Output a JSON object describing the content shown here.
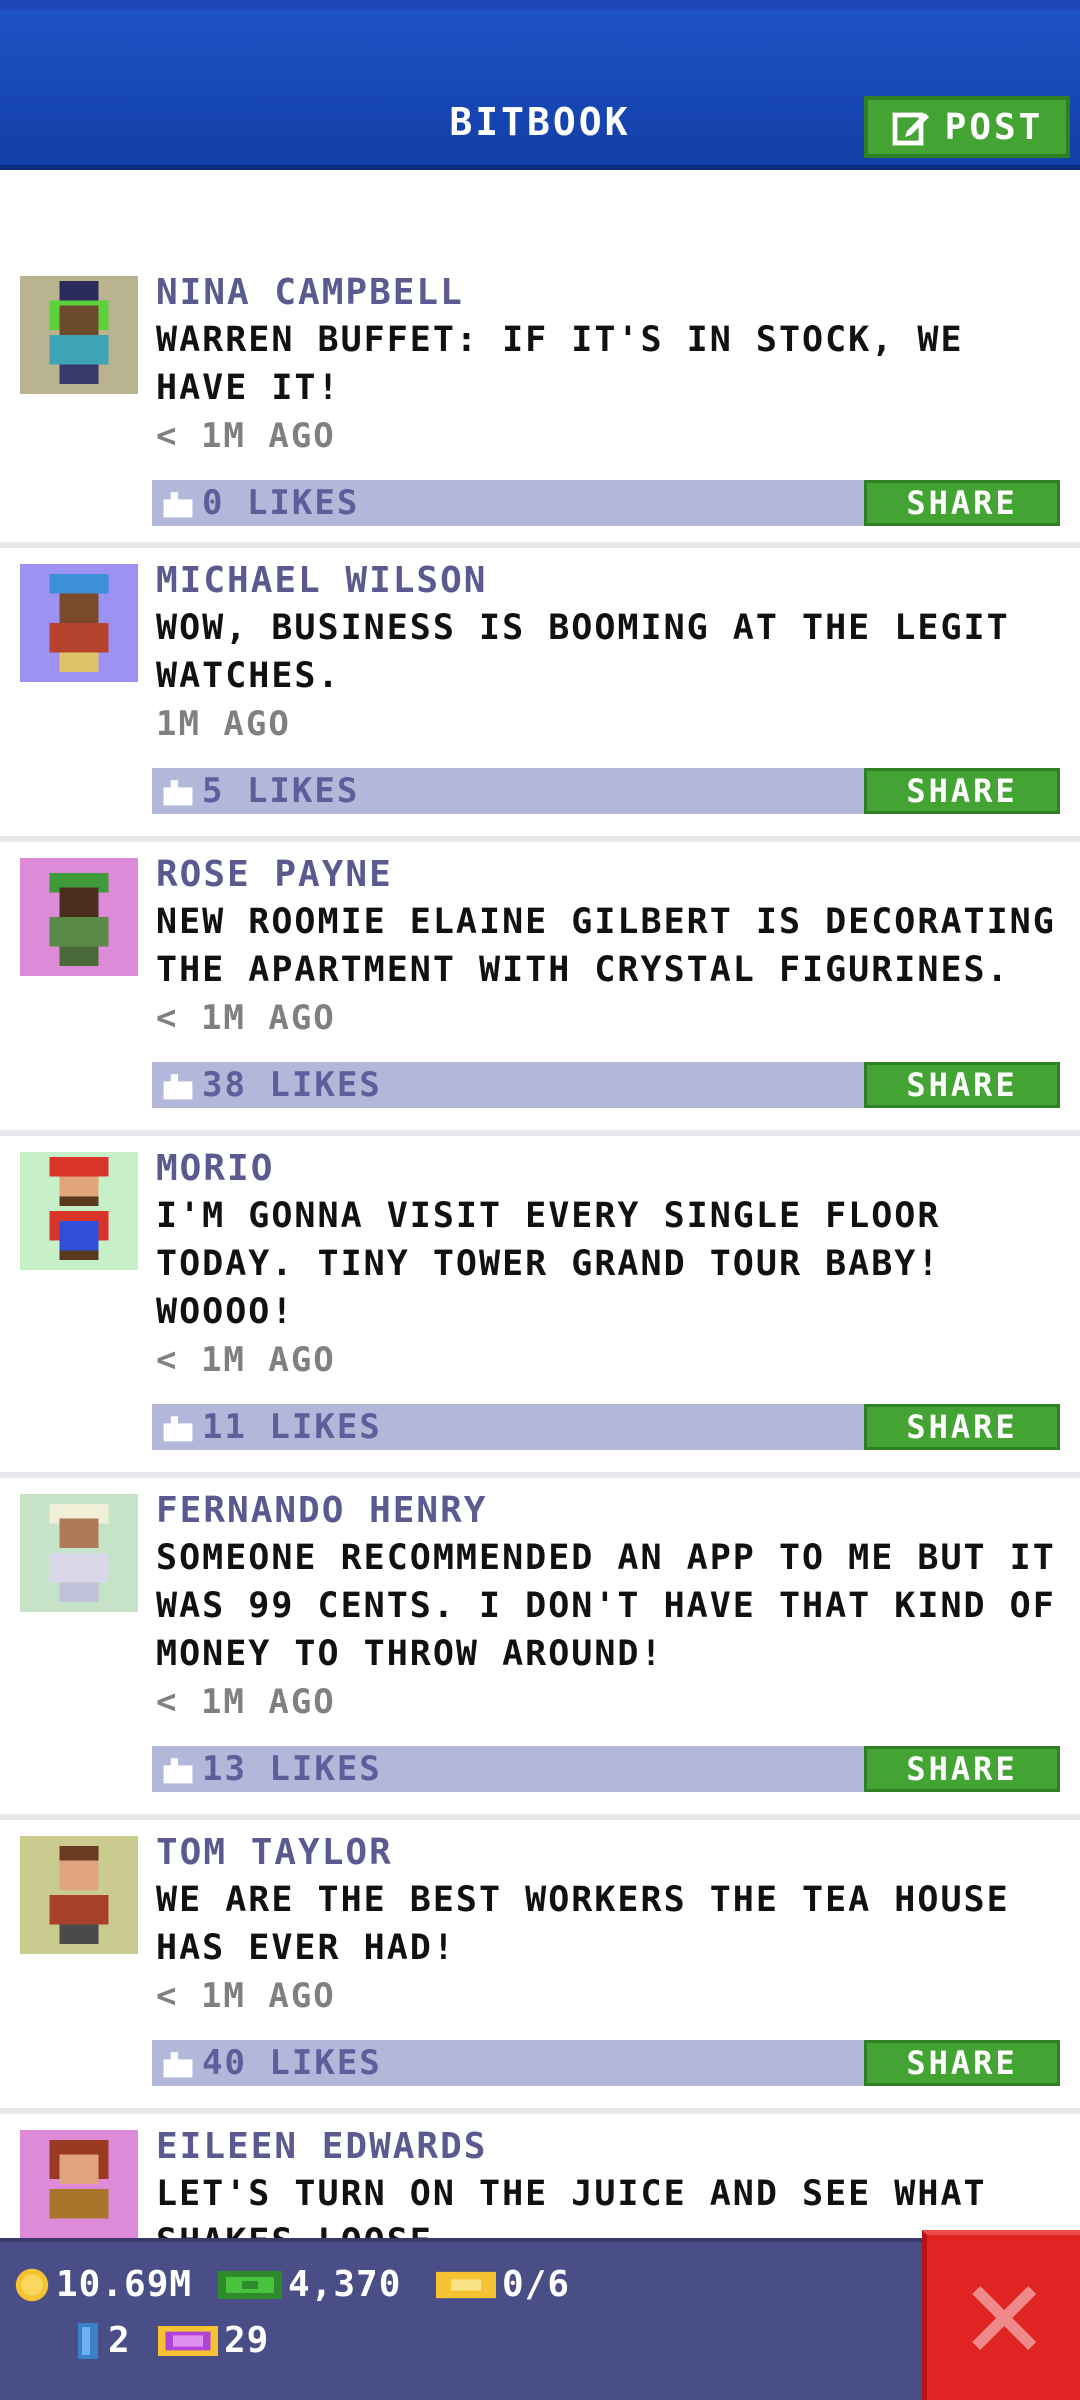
{
  "header": {
    "title": "BITBOOK",
    "post_label": "POST"
  },
  "posts": [
    {
      "name": "NINA CAMPBELL",
      "text": "WARREN BUFFET: IF IT'S IN STOCK, WE HAVE IT!",
      "time": "< 1M AGO",
      "likes": "0 LIKES",
      "share": "SHARE"
    },
    {
      "name": "MICHAEL WILSON",
      "text": "WOW, BUSINESS IS BOOMING AT THE LEGIT WATCHES.",
      "time": "1M AGO",
      "likes": "5 LIKES",
      "share": "SHARE"
    },
    {
      "name": "ROSE PAYNE",
      "text": "NEW ROOMIE ELAINE GILBERT IS DECORATING THE APARTMENT WITH CRYSTAL FIGURINES.",
      "time": "< 1M AGO",
      "likes": "38 LIKES",
      "share": "SHARE"
    },
    {
      "name": "MORIO",
      "text": "I'M GONNA VISIT EVERY SINGLE FLOOR TODAY. TINY TOWER GRAND TOUR BABY! WOOOO!",
      "time": "< 1M AGO",
      "likes": "11 LIKES",
      "share": "SHARE"
    },
    {
      "name": "FERNANDO HENRY",
      "text": "SOMEONE RECOMMENDED AN APP TO ME BUT IT WAS 99 CENTS. I DON'T HAVE THAT KIND OF MONEY TO THROW AROUND!",
      "time": "< 1M AGO",
      "likes": "13 LIKES",
      "share": "SHARE"
    },
    {
      "name": "TOM TAYLOR",
      "text": "WE ARE THE BEST WORKERS THE TEA HOUSE HAS EVER HAD!",
      "time": "< 1M AGO",
      "likes": "40 LIKES",
      "share": "SHARE"
    },
    {
      "name": "EILEEN EDWARDS",
      "text": "LET'S TURN ON THE JUICE AND SEE WHAT SHAKES LOOSE",
      "time": "",
      "likes": "",
      "share": ""
    }
  ],
  "status": {
    "coins": "10.69M",
    "bux": "4,370",
    "tickets": "0/6",
    "keys": "2",
    "vip": "29"
  },
  "icons": {
    "coin": "gold-coin-icon",
    "bux": "bux-bill-icon",
    "ticket": "golden-ticket-icon",
    "key": "key-icon",
    "vip": "vip-card-icon",
    "close": "close-x-icon"
  },
  "colors": {
    "header": "#1e52c4",
    "share_green": "#43a433",
    "like_bar": "#b3b7da",
    "name_text": "#5a5a90",
    "close_red": "#e02424"
  }
}
